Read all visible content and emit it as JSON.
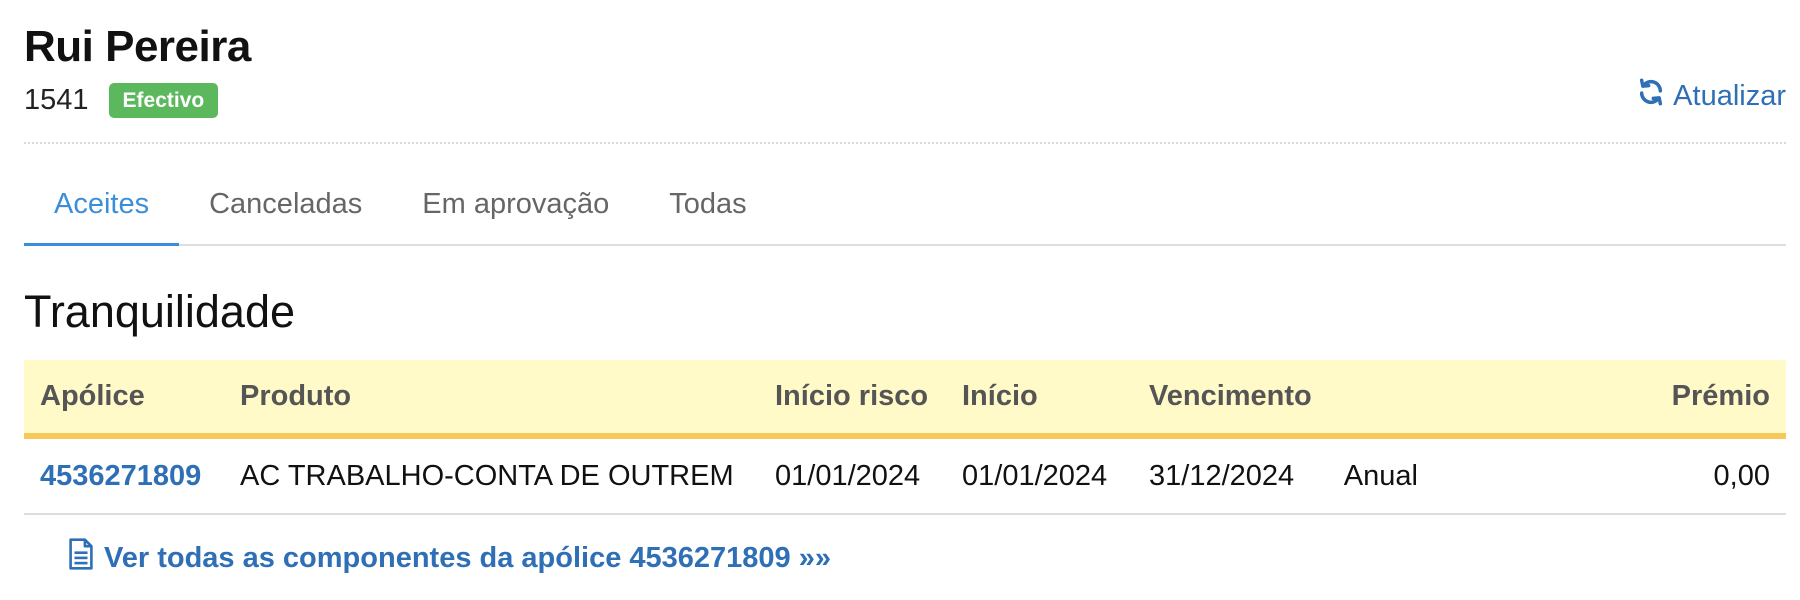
{
  "client": {
    "name": "Rui Pereira",
    "id": "1541",
    "status": "Efectivo",
    "status_color": "#5cb85c"
  },
  "header": {
    "refresh_label": "Atualizar",
    "refresh_icon": "refresh-icon"
  },
  "tabs": [
    {
      "label": "Aceites",
      "active": true
    },
    {
      "label": "Canceladas",
      "active": false
    },
    {
      "label": "Em aprovação",
      "active": false
    },
    {
      "label": "Todas",
      "active": false
    }
  ],
  "section": {
    "title": "Tranquilidade"
  },
  "table": {
    "columns": [
      "Apólice",
      "Produto",
      "Início risco",
      "Início",
      "Vencimento",
      "",
      "Prémio"
    ],
    "rows": [
      {
        "apolice": "4536271809",
        "produto": "AC TRABALHO-CONTA DE OUTREM",
        "inicio_risco": "01/01/2024",
        "inicio": "01/01/2024",
        "vencimento": "31/12/2024",
        "periodicidade": "Anual",
        "premio": "0,00"
      }
    ]
  },
  "components_link": {
    "label": "Ver todas as componentes da apólice 4536271809 »»",
    "icon": "document-icon"
  },
  "colors": {
    "link": "#2e6fb5",
    "active_tab": "#3b8fd9",
    "table_header_bg": "#fffac8",
    "table_header_border": "#f7c95a"
  }
}
